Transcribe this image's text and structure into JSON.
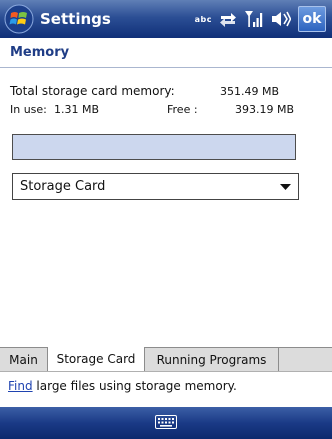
{
  "titlebar": {
    "title": "Settings",
    "input_mode": "abc",
    "ok_label": "ok",
    "icons": [
      "windows-start-icon",
      "connectivity-icon",
      "signal-icon",
      "volume-icon"
    ]
  },
  "header": {
    "title": "Memory"
  },
  "memory": {
    "total_label": "Total storage card memory:",
    "total_value": "351.49 MB",
    "in_use_label": "In use:",
    "in_use_value": "1.31 MB",
    "free_label": "Free :",
    "free_value": "393.19 MB",
    "usage_fraction": 0.0
  },
  "dropdown": {
    "selected": "Storage Card"
  },
  "tabs": [
    {
      "label": "Main",
      "active": false
    },
    {
      "label": "Storage Card",
      "active": true
    },
    {
      "label": "Running Programs",
      "active": false
    }
  ],
  "hint": {
    "link": "Find",
    "text": " large files using storage memory."
  },
  "softbar": {
    "icon": "keyboard-icon"
  },
  "colors": {
    "title_bar": "#2c4f95",
    "header_text": "#1f3d86",
    "progress_fill": "#ccd7ee",
    "link": "#1f43b0"
  }
}
